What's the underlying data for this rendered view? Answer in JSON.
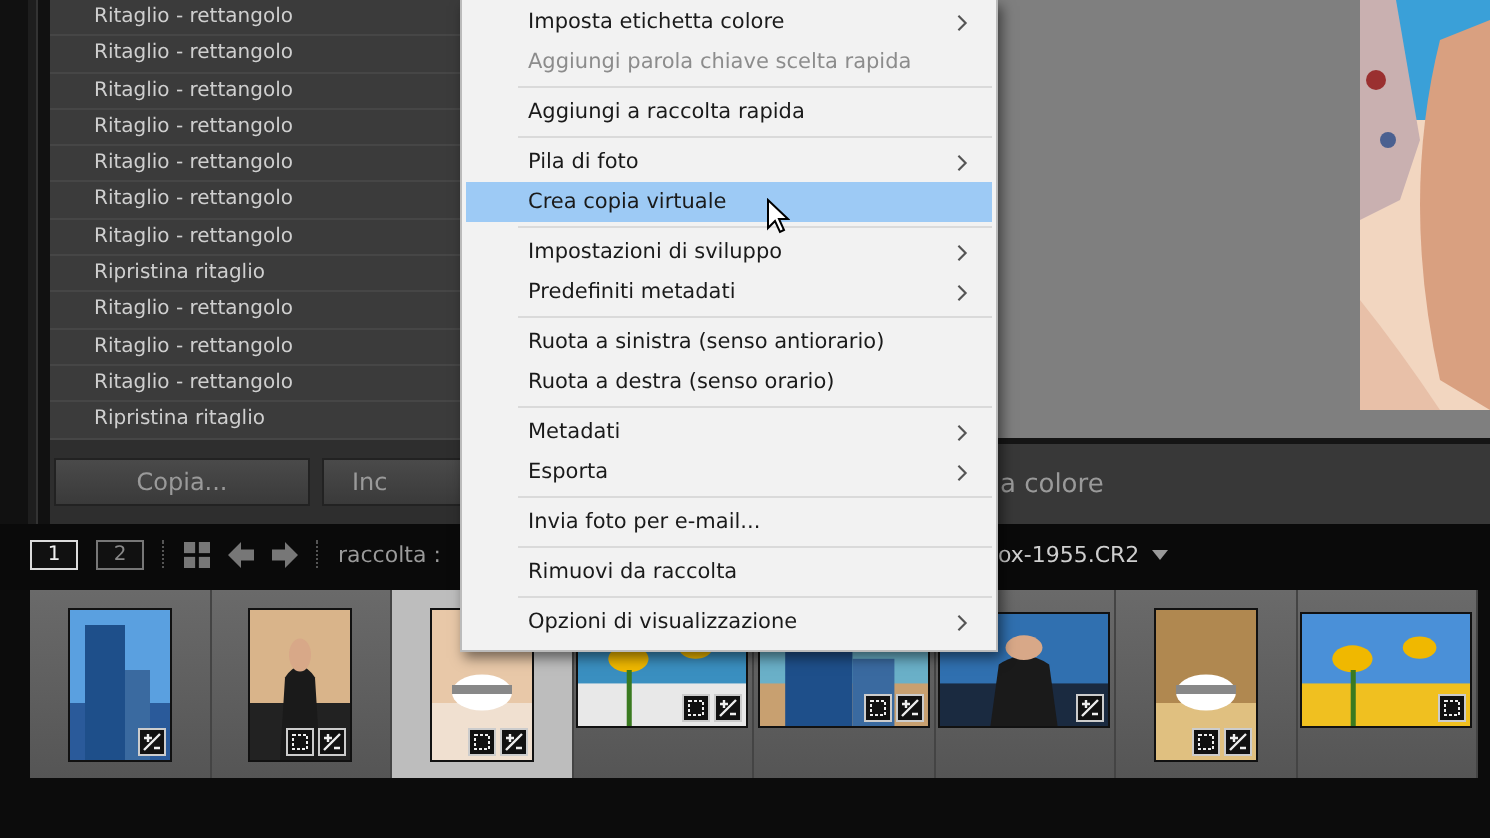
{
  "history": {
    "items": [
      "Ritaglio - rettangolo",
      "Ritaglio - rettangolo",
      "Ritaglio - rettangolo",
      "Ritaglio - rettangolo",
      "Ritaglio - rettangolo",
      "Ritaglio - rettangolo",
      "Ritaglio - rettangolo",
      "Ripristina ritaglio",
      "Ritaglio - rettangolo",
      "Ritaglio - rettangolo",
      "Ritaglio - rettangolo",
      "Ripristina ritaglio"
    ]
  },
  "buttons": [
    {
      "label": "Copia..."
    },
    {
      "label": "Inc"
    }
  ],
  "bottom_bar": {
    "text": "a colore"
  },
  "context_menu": {
    "groups": [
      [
        {
          "label": "Imposta etichetta colore",
          "disabled": false,
          "submenu": true,
          "selected": false
        },
        {
          "label": "Aggiungi parola chiave scelta rapida",
          "disabled": true,
          "submenu": false,
          "selected": false
        }
      ],
      [
        {
          "label": "Aggiungi a raccolta rapida",
          "disabled": false,
          "submenu": false,
          "selected": false
        }
      ],
      [
        {
          "label": "Pila di foto",
          "disabled": false,
          "submenu": true,
          "selected": false
        },
        {
          "label": "Crea copia virtuale",
          "disabled": false,
          "submenu": false,
          "selected": true
        }
      ],
      [
        {
          "label": "Impostazioni di sviluppo",
          "disabled": false,
          "submenu": true,
          "selected": false
        },
        {
          "label": "Predefiniti metadati",
          "disabled": false,
          "submenu": true,
          "selected": false
        }
      ],
      [
        {
          "label": "Ruota a sinistra (senso antiorario)",
          "disabled": false,
          "submenu": false,
          "selected": false
        },
        {
          "label": "Ruota a destra (senso orario)",
          "disabled": false,
          "submenu": false,
          "selected": false
        }
      ],
      [
        {
          "label": "Metadati",
          "disabled": false,
          "submenu": true,
          "selected": false
        },
        {
          "label": "Esporta",
          "disabled": false,
          "submenu": true,
          "selected": false
        }
      ],
      [
        {
          "label": "Invia foto per e-mail...",
          "disabled": false,
          "submenu": false,
          "selected": false
        }
      ],
      [
        {
          "label": "Rimuovi da raccolta",
          "disabled": false,
          "submenu": false,
          "selected": false
        }
      ],
      [
        {
          "label": "Opzioni di visualizzazione",
          "disabled": false,
          "submenu": true,
          "selected": false
        }
      ]
    ]
  },
  "toolbar": {
    "views": [
      {
        "label": "1",
        "selected": true
      },
      {
        "label": "2",
        "selected": false
      }
    ],
    "source": "raccolta :",
    "filename": "ox-1955.CR2"
  },
  "filmstrip": [
    {
      "portrait": true,
      "selected": false,
      "cropped": false,
      "edited": true
    },
    {
      "portrait": true,
      "selected": false,
      "cropped": true,
      "edited": true
    },
    {
      "portrait": true,
      "selected": true,
      "cropped": true,
      "edited": true
    },
    {
      "portrait": false,
      "selected": false,
      "cropped": true,
      "edited": true
    },
    {
      "portrait": false,
      "selected": false,
      "cropped": true,
      "edited": true
    },
    {
      "portrait": false,
      "selected": false,
      "cropped": false,
      "edited": true
    },
    {
      "portrait": true,
      "selected": false,
      "cropped": true,
      "edited": true
    },
    {
      "portrait": false,
      "selected": false,
      "cropped": true,
      "edited": false
    }
  ]
}
